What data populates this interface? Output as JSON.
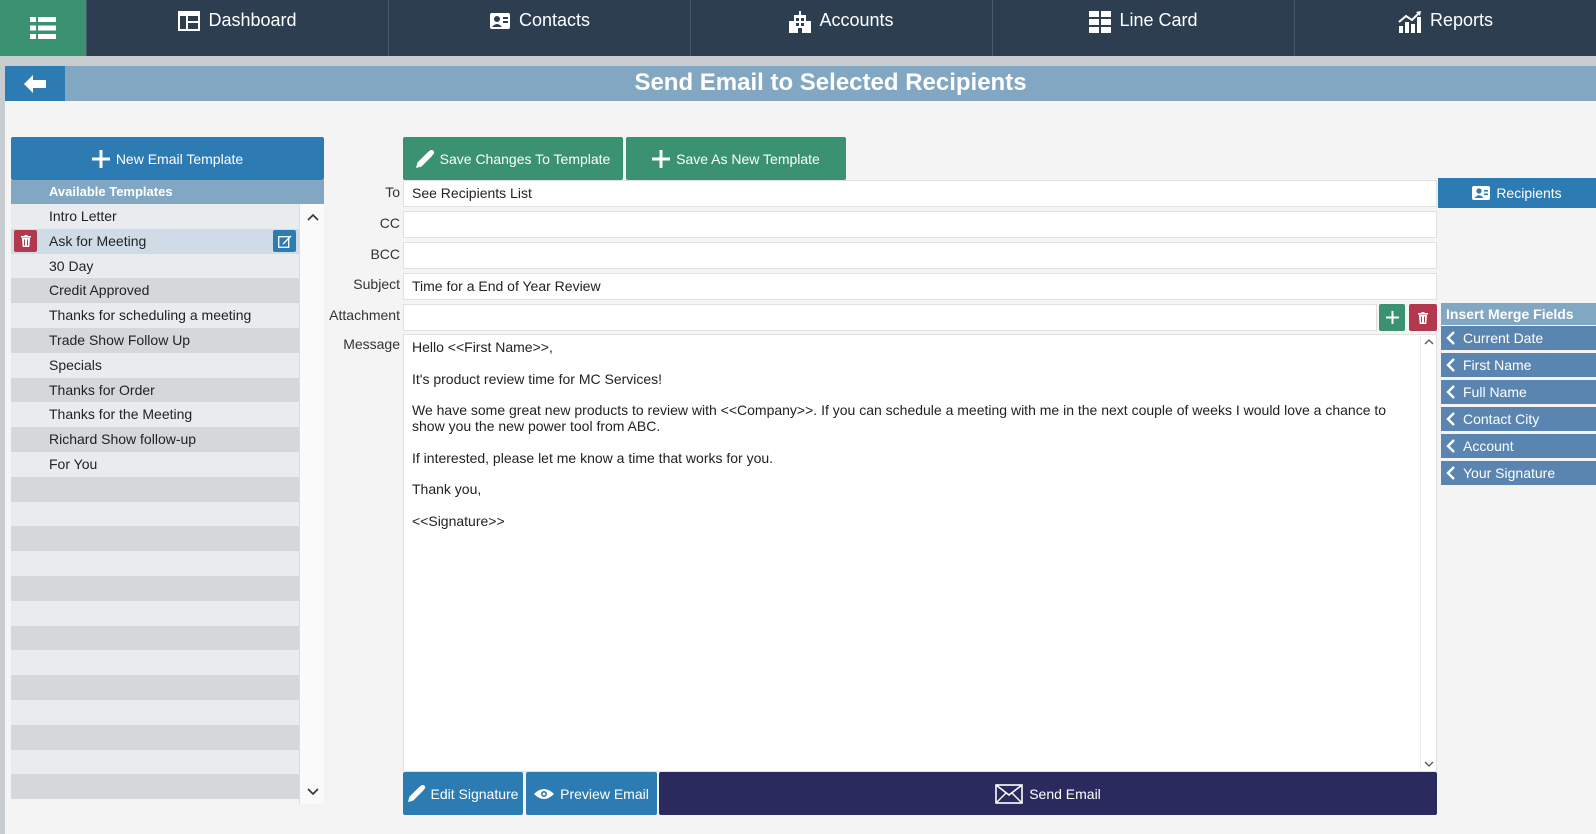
{
  "nav": {
    "tabs": [
      {
        "label": "Dashboard",
        "icon": "dashboard-icon"
      },
      {
        "label": "Contacts",
        "icon": "contacts-icon"
      },
      {
        "label": "Accounts",
        "icon": "accounts-icon"
      },
      {
        "label": "Line Card",
        "icon": "line-card-icon"
      },
      {
        "label": "Reports",
        "icon": "reports-icon"
      }
    ]
  },
  "page": {
    "title": "Send Email to Selected Recipients"
  },
  "templates": {
    "new_button": "New Email Template",
    "header": "Available Templates",
    "items": [
      "Intro Letter",
      "Ask for Meeting",
      "30 Day",
      "Credit Approved",
      "Thanks for scheduling a meeting",
      "Trade Show Follow Up",
      "Specials",
      "Thanks for Order",
      "Thanks for the Meeting",
      "Richard Show follow-up",
      "For You"
    ],
    "selected": "Ask for Meeting"
  },
  "actions": {
    "save_changes": "Save Changes To Template",
    "save_new": "Save As New Template",
    "recipients": "Recipients",
    "edit_signature": "Edit Signature",
    "preview": "Preview Email",
    "send": "Send Email"
  },
  "form": {
    "labels": {
      "to": "To",
      "cc": "CC",
      "bcc": "BCC",
      "subject": "Subject",
      "attachment": "Attachment",
      "message": "Message"
    },
    "to": "See Recipients List",
    "cc": "",
    "bcc": "",
    "subject": "Time for a End of Year Review",
    "attachment": "",
    "message": [
      "Hello <<First Name>>,",
      "It's product review time for MC Services!",
      "We have some great new products to review with <<Company>>. If you can schedule a meeting with me in the next couple of weeks I would love a chance to show you the new power tool from ABC.",
      "If interested, please let me know a time that works for you.",
      "Thank you,",
      "<<Signature>>"
    ]
  },
  "merge_fields": {
    "header": "Insert Merge Fields",
    "items": [
      "Current Date",
      "First Name",
      "Full Name",
      "Contact City",
      "Account",
      "Your Signature"
    ]
  },
  "colors": {
    "nav_bg": "#2c3e50",
    "green": "#3a9270",
    "blue": "#2d7bb3",
    "light_blue": "#82a7c2",
    "merge_blue": "#5a85b0",
    "red": "#b2394d",
    "navy": "#2a2a5e"
  }
}
